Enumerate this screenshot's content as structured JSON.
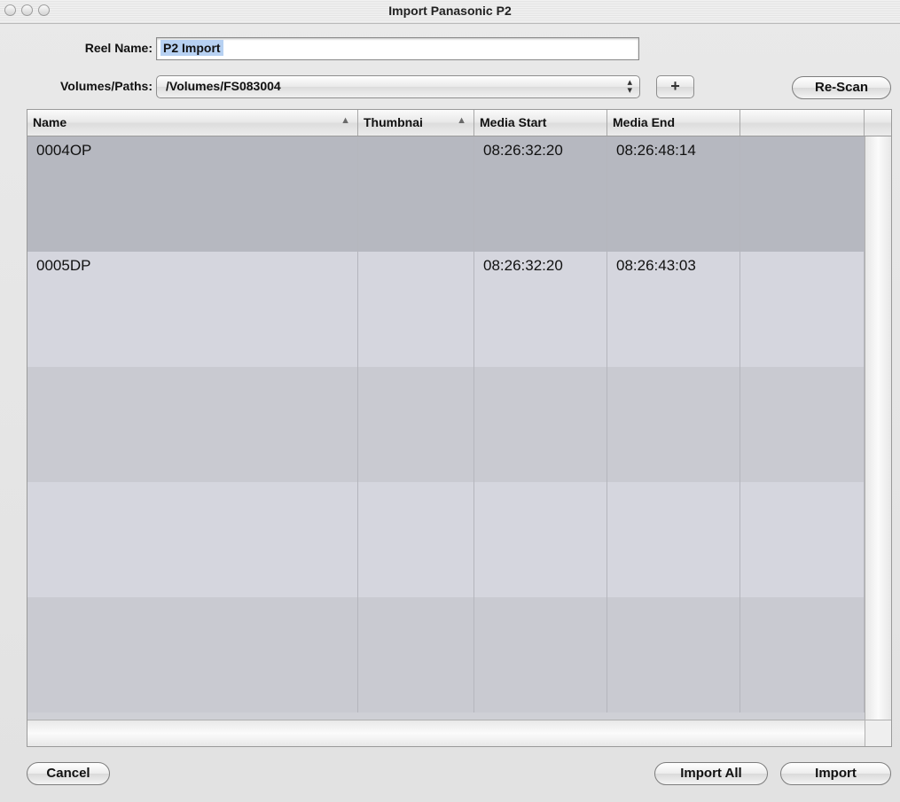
{
  "window": {
    "title": "Import Panasonic P2"
  },
  "form": {
    "reel_name_label": "Reel Name:",
    "reel_name_value": "P2 Import",
    "volumes_label": "Volumes/Paths:",
    "volumes_value": "/Volumes/FS083004",
    "add_label": "+",
    "rescan_label": "Re-Scan"
  },
  "table": {
    "columns": [
      "Name",
      "Thumbnai",
      "Media Start",
      "Media End",
      ""
    ],
    "rows": [
      {
        "name": "0004OP",
        "thumbnail": "",
        "media_start": "08:26:32:20",
        "media_end": "08:26:48:14"
      },
      {
        "name": "0005DP",
        "thumbnail": "",
        "media_start": "08:26:32:20",
        "media_end": "08:26:43:03"
      }
    ]
  },
  "buttons": {
    "cancel": "Cancel",
    "import_all": "Import All",
    "import": "Import"
  },
  "colors": {
    "selected_row": "#b6b8c0",
    "row_alt_light": "#d5d6de",
    "row_alt_dark": "#c9cad1"
  }
}
